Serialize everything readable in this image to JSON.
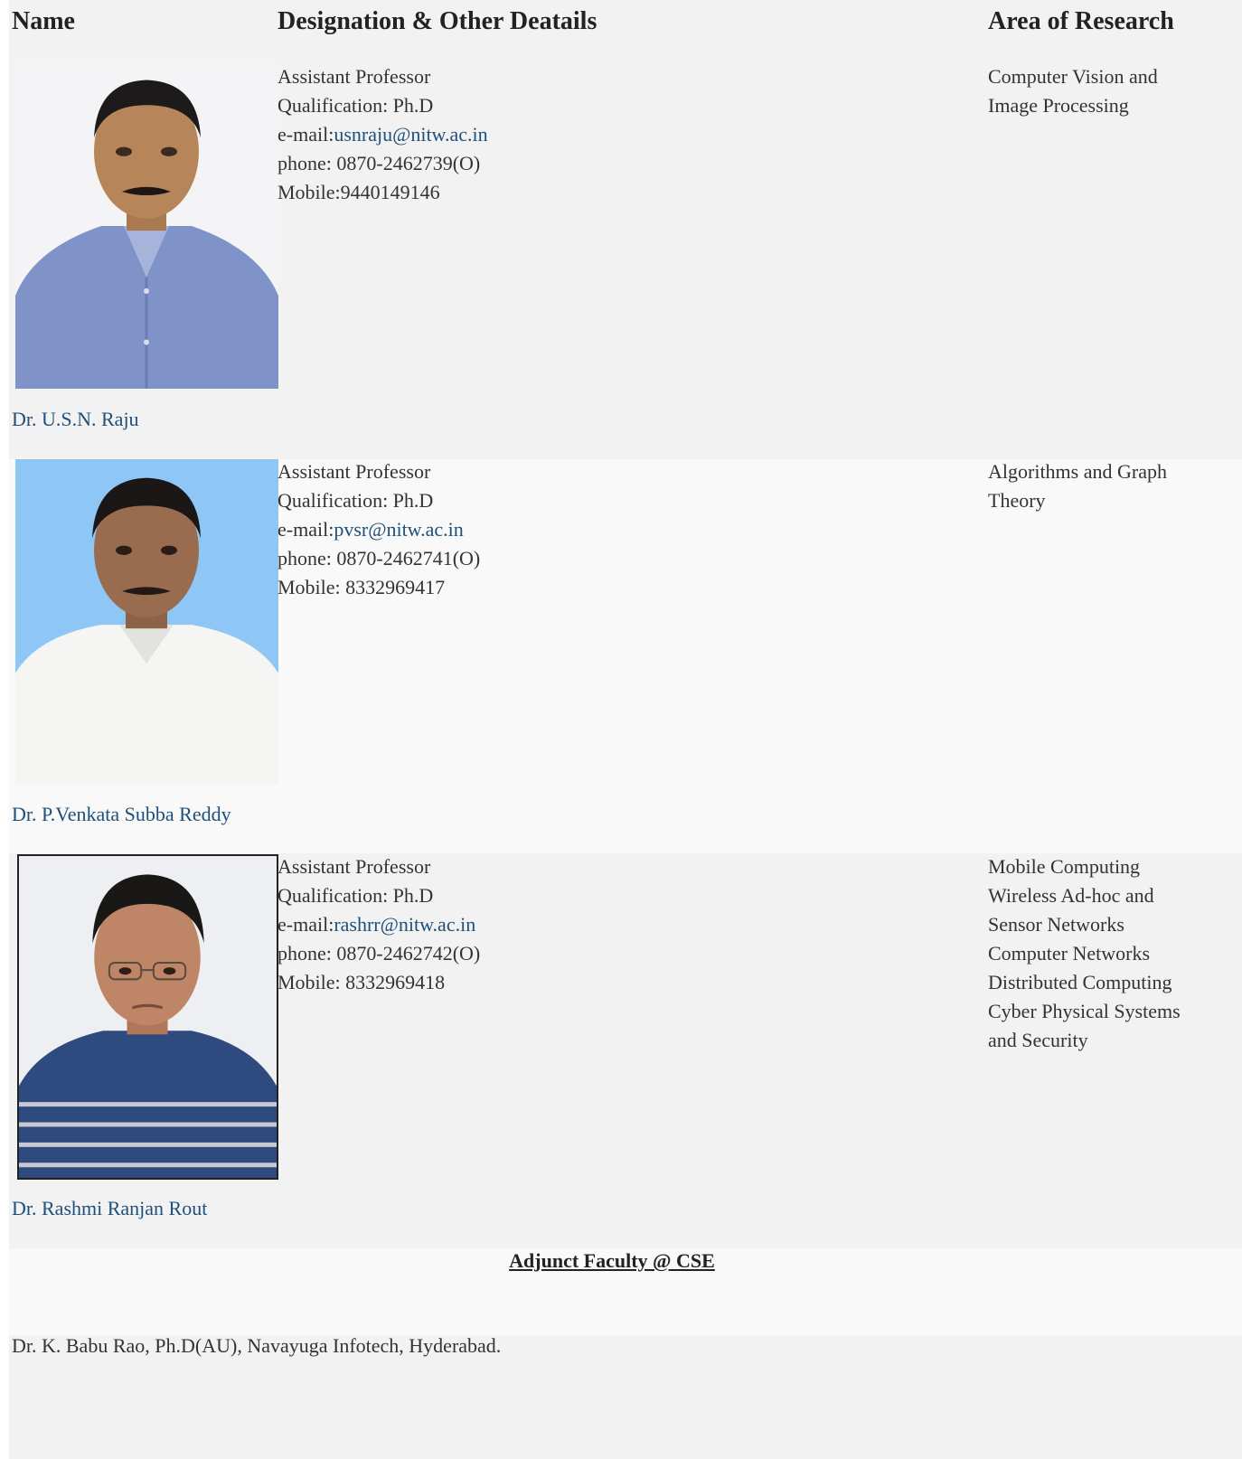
{
  "headers": {
    "name": "Name",
    "designation": "Designation & Other Deatails",
    "research": "Area of Research"
  },
  "faculty": [
    {
      "name": "Dr. U.S.N. Raju",
      "designation": "Assistant Professor",
      "qualification": "Qualification: Ph.D",
      "email_label": "e-mail:",
      "email": "usnraju@nitw.ac.in",
      "phone": "phone: 0870-2462739(O)",
      "mobile": "Mobile:9440149146",
      "research": [
        "Computer Vision and",
        "Image Processing"
      ]
    },
    {
      "name": "Dr. P.Venkata Subba Reddy",
      "designation": "Assistant Professor",
      "qualification": "Qualification: Ph.D",
      "email_label": "e-mail:",
      "email": "pvsr@nitw.ac.in",
      "phone": "phone: 0870-2462741(O)",
      "mobile": "Mobile: 8332969417",
      "research": [
        "Algorithms and Graph",
        "Theory"
      ]
    },
    {
      "name": "Dr. Rashmi Ranjan Rout",
      "designation": "Assistant Professor",
      "qualification": "Qualification: Ph.D",
      "email_label": "e-mail:",
      "email": "rashrr@nitw.ac.in",
      "phone": "phone: 0870-2462742(O)",
      "mobile": "Mobile: 8332969418",
      "research": [
        "Mobile Computing",
        "Wireless Ad-hoc and",
        "Sensor Networks",
        "Computer Networks",
        "Distributed Computing",
        "Cyber Physical Systems",
        "and Security"
      ]
    }
  ],
  "adjunct": {
    "title": "Adjunct Faculty @ CSE",
    "members": [
      "Dr. K. Babu Rao, Ph.D(AU), Navayuga Infotech, Hyderabad."
    ]
  },
  "colors": {
    "link": "#1f4f7a",
    "band_gray": "#f2f2f2",
    "band_light": "#f9f9f9"
  }
}
